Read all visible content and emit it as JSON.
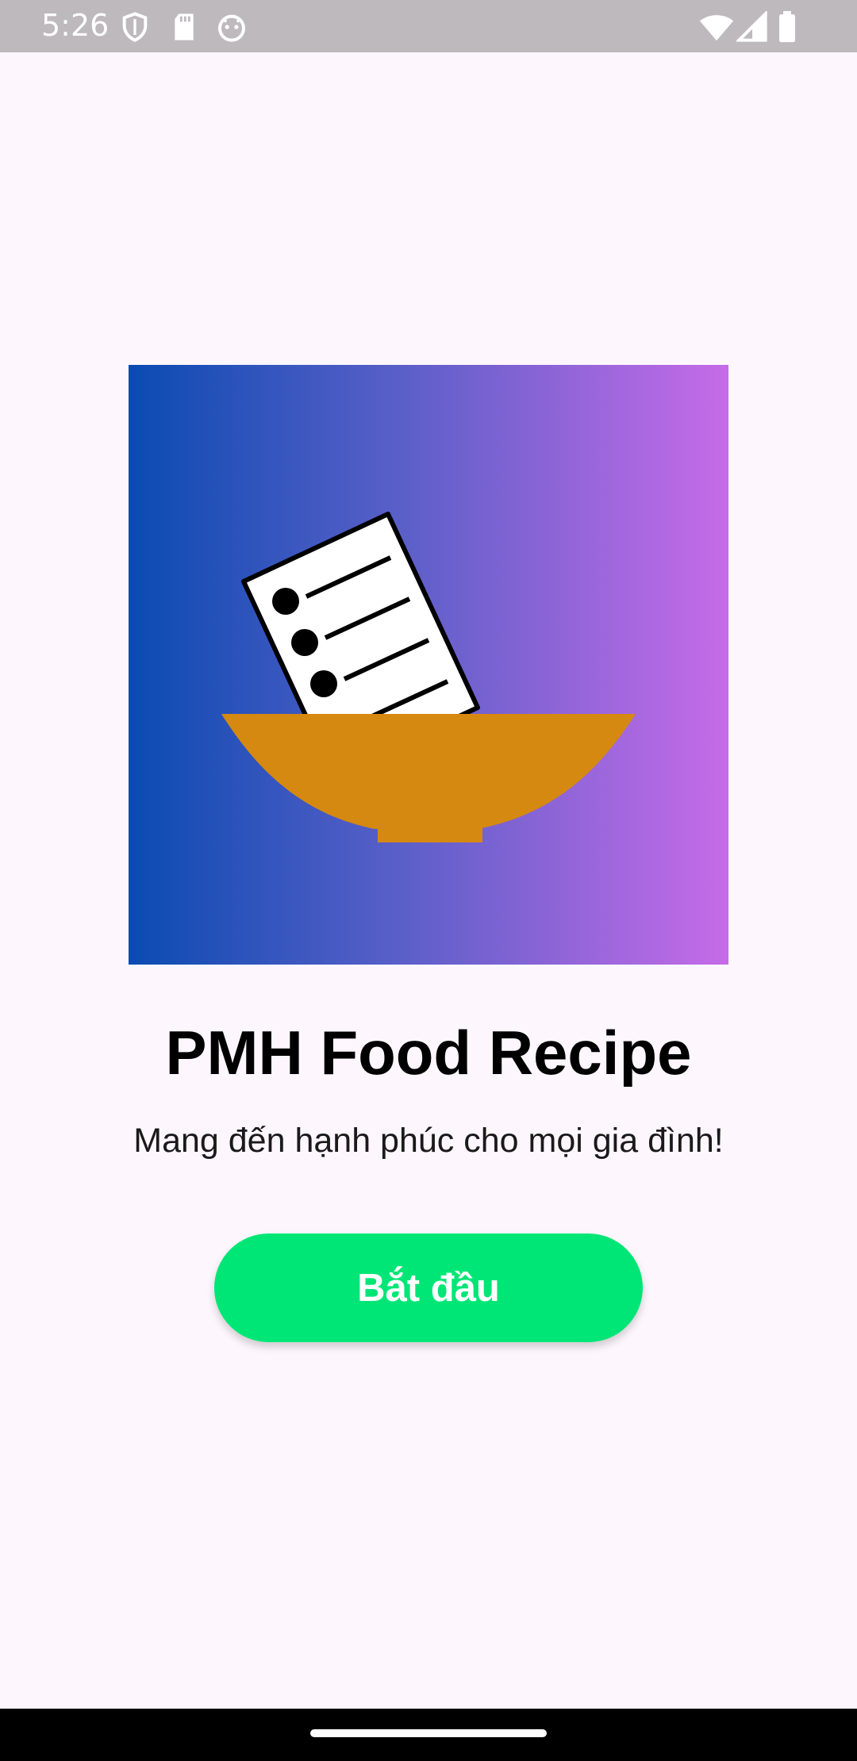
{
  "status_bar": {
    "time": "5:26",
    "icons_left": [
      "shield-icon",
      "sd-card-icon",
      "android-icon"
    ],
    "icons_right": [
      "wifi-icon",
      "cellular-signal-icon",
      "battery-icon"
    ]
  },
  "app": {
    "title": "PMH Food Recipe",
    "subtitle": "Mang đến hạnh phúc cho mọi gia đình!",
    "start_button": "Bắt đầu",
    "logo_icon": "recipe-bowl-icon"
  },
  "colors": {
    "background": "#FDF7FD",
    "button": "#00E676",
    "gradient_start": "#0A4BB2",
    "gradient_end": "#C66BE8",
    "bowl": "#D68910"
  }
}
